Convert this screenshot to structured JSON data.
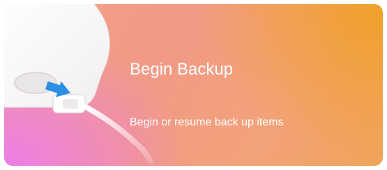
{
  "card": {
    "title": "Begin Backup",
    "subtitle": "Begin or resume back up items",
    "illustration_icon": "phone-with-usb-cable-icon",
    "colors": {
      "gradient_pink": "#ec7cee",
      "gradient_salmon": "#f19a86",
      "gradient_orange": "#f0a028",
      "arrow_blue": "#2b8fe6",
      "text": "#ffffff"
    }
  }
}
